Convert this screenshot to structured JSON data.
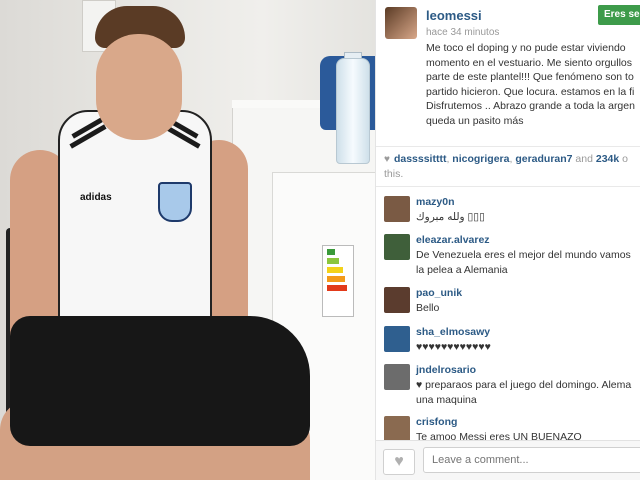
{
  "photo": {
    "alt_subject": "",
    "shirt_brand": "adidas"
  },
  "post": {
    "username": "leomessi",
    "time": "hace 34 minutos",
    "follow_label": "Eres se",
    "caption": "Me toco el doping y no pude estar viviendo momento en el vestuario. Me siento orgullos parte de este plantel!!! Que fenómeno son to partido hicieron. Que locura. estamos en la fi Disfrutemos .. Abrazo grande a toda la argen queda un pasito más"
  },
  "likes": {
    "users": [
      "dassssitttt",
      "nicogrigera",
      "geraduran7"
    ],
    "sep1": ", ",
    "sep2": ", ",
    "tail": " and ",
    "count": "234k",
    "rest": " o",
    "end": "this."
  },
  "comments": [
    {
      "user": "mazy0n",
      "text": "ولله مبروك ▯▯▯",
      "avatar_color": "#7a5a44"
    },
    {
      "user": "eleazar.alvarez",
      "text": "De Venezuela eres el mejor del mundo vamos la pelea a Alemania",
      "avatar_color": "#3f5f3a"
    },
    {
      "user": "pao_unik",
      "text": "Bello",
      "avatar_color": "#5b3c2e"
    },
    {
      "user": "sha_elmosawy",
      "text": "♥♥♥♥♥♥♥♥♥♥♥♥",
      "avatar_color": "#2f5f8f"
    },
    {
      "user": "jndelrosario",
      "text": "♥ preparaos para el juego del domingo. Alema una maquina",
      "avatar_color": "#6c6c6c"
    },
    {
      "user": "crisfong",
      "text": "Te amoo Messi eres UN BUENAZO",
      "avatar_color": "#8a6a50"
    }
  ],
  "footer": {
    "input_placeholder": "Leave a comment..."
  },
  "colors": {
    "link": "#2c5a85",
    "follow_bg": "#3d9b4a"
  }
}
